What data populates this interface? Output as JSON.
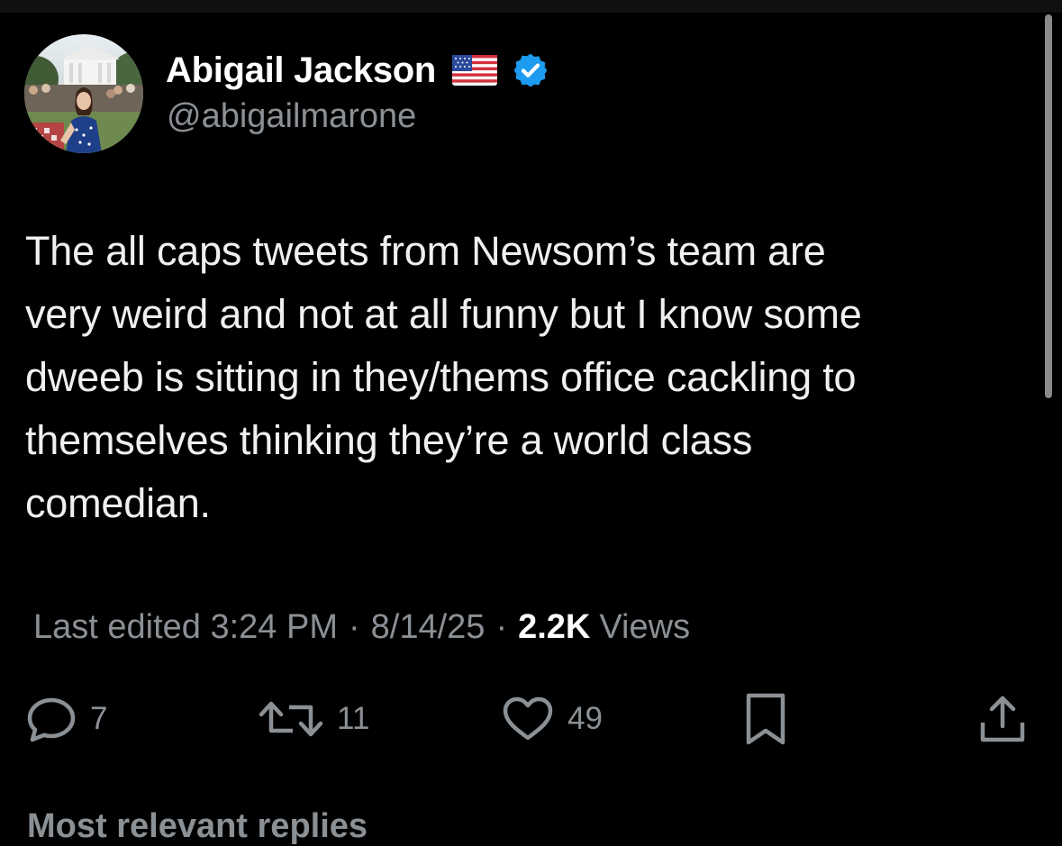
{
  "author": {
    "display_name": "Abigail Jackson",
    "handle": "@abigailmarone",
    "flag": "us-flag-emoji",
    "verified_icon": "verified-badge-icon",
    "verified_color": "#1d9bf0"
  },
  "tweet": {
    "text": "The all caps tweets from Newsom’s team are\nvery weird and not at all funny but I know some\ndweeb is sitting in they/thems office cackling to\nthemselves thinking they’re a world class\ncomedian."
  },
  "meta": {
    "edited": "Last edited 3:24 PM",
    "separator": "·",
    "date": "8/14/25",
    "views_count": "2.2K",
    "views_label": "Views"
  },
  "actions": {
    "reply": {
      "icon": "reply-icon",
      "count": "7"
    },
    "repost": {
      "icon": "repost-icon",
      "count": "11"
    },
    "like": {
      "icon": "heart-icon",
      "count": "49"
    },
    "bookmark": {
      "icon": "bookmark-icon"
    },
    "share": {
      "icon": "share-icon"
    }
  },
  "replies": {
    "heading": "Most relevant replies"
  },
  "colors": {
    "background": "#000000",
    "text": "#e7e9ea",
    "muted": "#8b9095",
    "accent": "#1d9bf0"
  }
}
